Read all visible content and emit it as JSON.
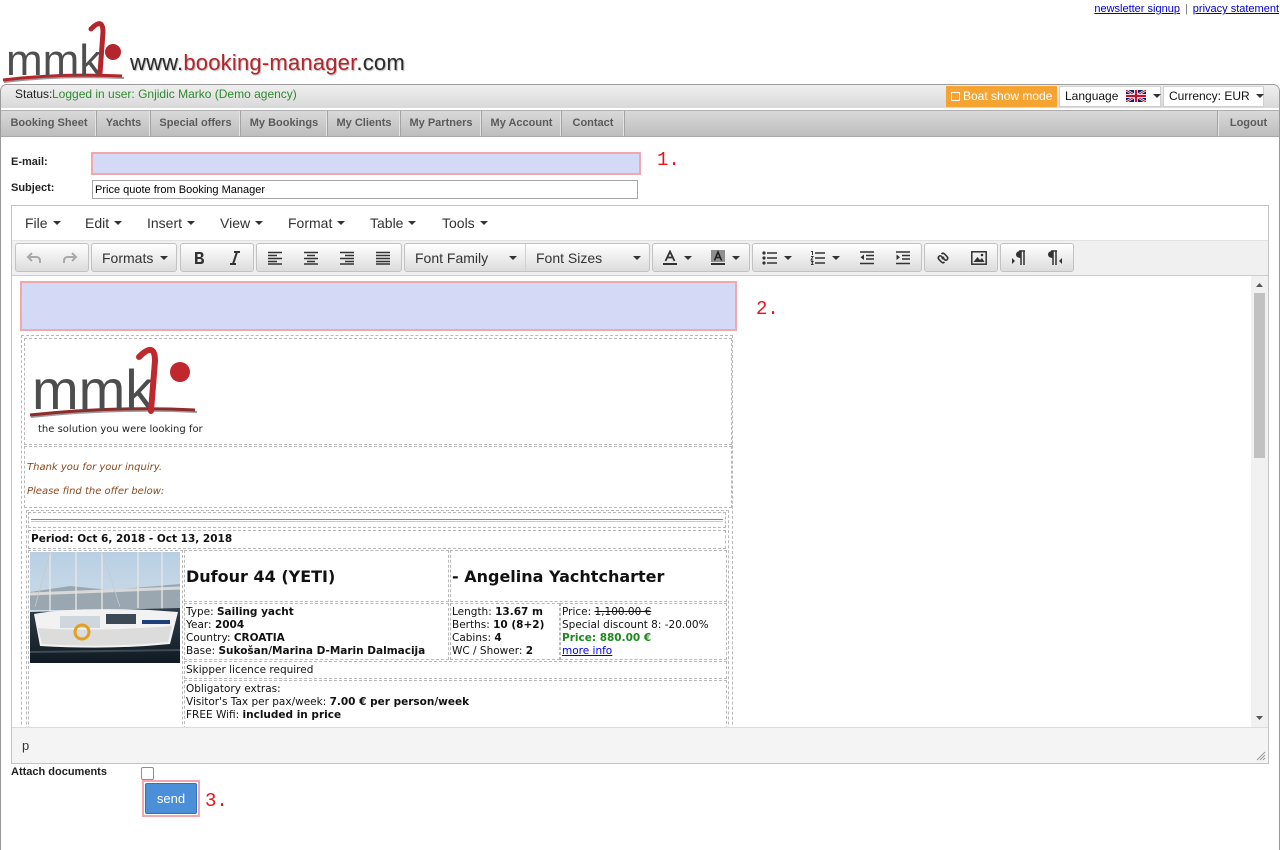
{
  "top_links": {
    "newsletter": "newsletter signup",
    "separator": "|",
    "privacy": "privacy statement"
  },
  "brand": {
    "logo_mark": "mmk",
    "site_prefix": "www.",
    "site_name": "booking-manager",
    "site_suffix": ".com"
  },
  "status": {
    "label": "Status:",
    "user": "Logged in user: Gnjidic Marko (Demo agency)"
  },
  "controls": {
    "boat_show": "Boat show mode",
    "language": "Language",
    "language_flag": "uk-flag-icon",
    "currency": "Currency: EUR"
  },
  "nav": {
    "items": [
      "Booking Sheet",
      "Yachts",
      "Special offers",
      "My Bookings",
      "My Clients",
      "My Partners",
      "My Account",
      "Contact"
    ],
    "logout": "Logout"
  },
  "form": {
    "email_label": "E-mail:",
    "email_value": "",
    "subject_label": "Subject:",
    "subject_value": "Price quote from Booking Manager",
    "attach_label": "Attach documents",
    "attach_checked": false,
    "send_label": "send"
  },
  "markers": [
    "1.",
    "2.",
    "3."
  ],
  "editor": {
    "menu": [
      "File",
      "Edit",
      "Insert",
      "View",
      "Format",
      "Table",
      "Tools"
    ],
    "formats": "Formats",
    "font_family": "Font Family",
    "font_sizes": "Font Sizes",
    "toolbar_icons": [
      "undo-icon",
      "redo-icon",
      "bold-icon",
      "italic-icon",
      "align-left-icon",
      "align-center-icon",
      "align-right-icon",
      "align-justify-icon",
      "text-color-icon",
      "background-color-icon",
      "bullet-list-icon",
      "numbered-list-icon",
      "outdent-icon",
      "indent-icon",
      "link-icon",
      "image-icon",
      "ltr-icon",
      "rtl-icon"
    ],
    "path": "p"
  },
  "email": {
    "logo_mark": "mmk",
    "tagline": "the solution you were looking for",
    "greeting": "Thank you for your inquiry.",
    "offer_intro": "Please find the offer below:",
    "period_label": "Period:",
    "period": "Oct 6, 2018 - Oct 13, 2018",
    "yacht_name": "Dufour 44 (YETI)",
    "company": "- Angelina Yachtcharter",
    "specs_left": [
      {
        "label": "Type:",
        "value": "Sailing yacht"
      },
      {
        "label": "Year:",
        "value": "2004"
      },
      {
        "label": "Country:",
        "value": "CROATIA"
      },
      {
        "label": "Base:",
        "value": "Sukošan/Marina D-Marin Dalmacija"
      }
    ],
    "specs_mid": [
      {
        "label": "Length:",
        "value": "13.67 m"
      },
      {
        "label": "Berths:",
        "value": "10 (8+2)"
      },
      {
        "label": "Cabins:",
        "value": "4"
      },
      {
        "label": "WC / Shower:",
        "value": "2"
      }
    ],
    "price": {
      "label": "Price:",
      "original": "1,100.00 €",
      "discount": "Special discount 8: -20.00%",
      "final_label": "Price:",
      "final": "880.00 €",
      "more_info": "more info"
    },
    "skipper": "Skipper licence required",
    "extras_title": "Obligatory extras:",
    "extras": [
      {
        "label": "Visitor's Tax per pax/week:",
        "value": "7.00 € per person/week"
      },
      {
        "label": "FREE Wifi:",
        "value": "included in price"
      }
    ]
  },
  "colors": {
    "brand_red": "#b3262b",
    "status_green": "#2e8b2e",
    "boat_show_orange": "#f5a431",
    "highlight_fill": "#d4daf6",
    "highlight_border": "#f2a7ad",
    "send_blue": "#4a8fd8",
    "price_green": "#1d8a1d",
    "marker_red": "#e8141b"
  }
}
